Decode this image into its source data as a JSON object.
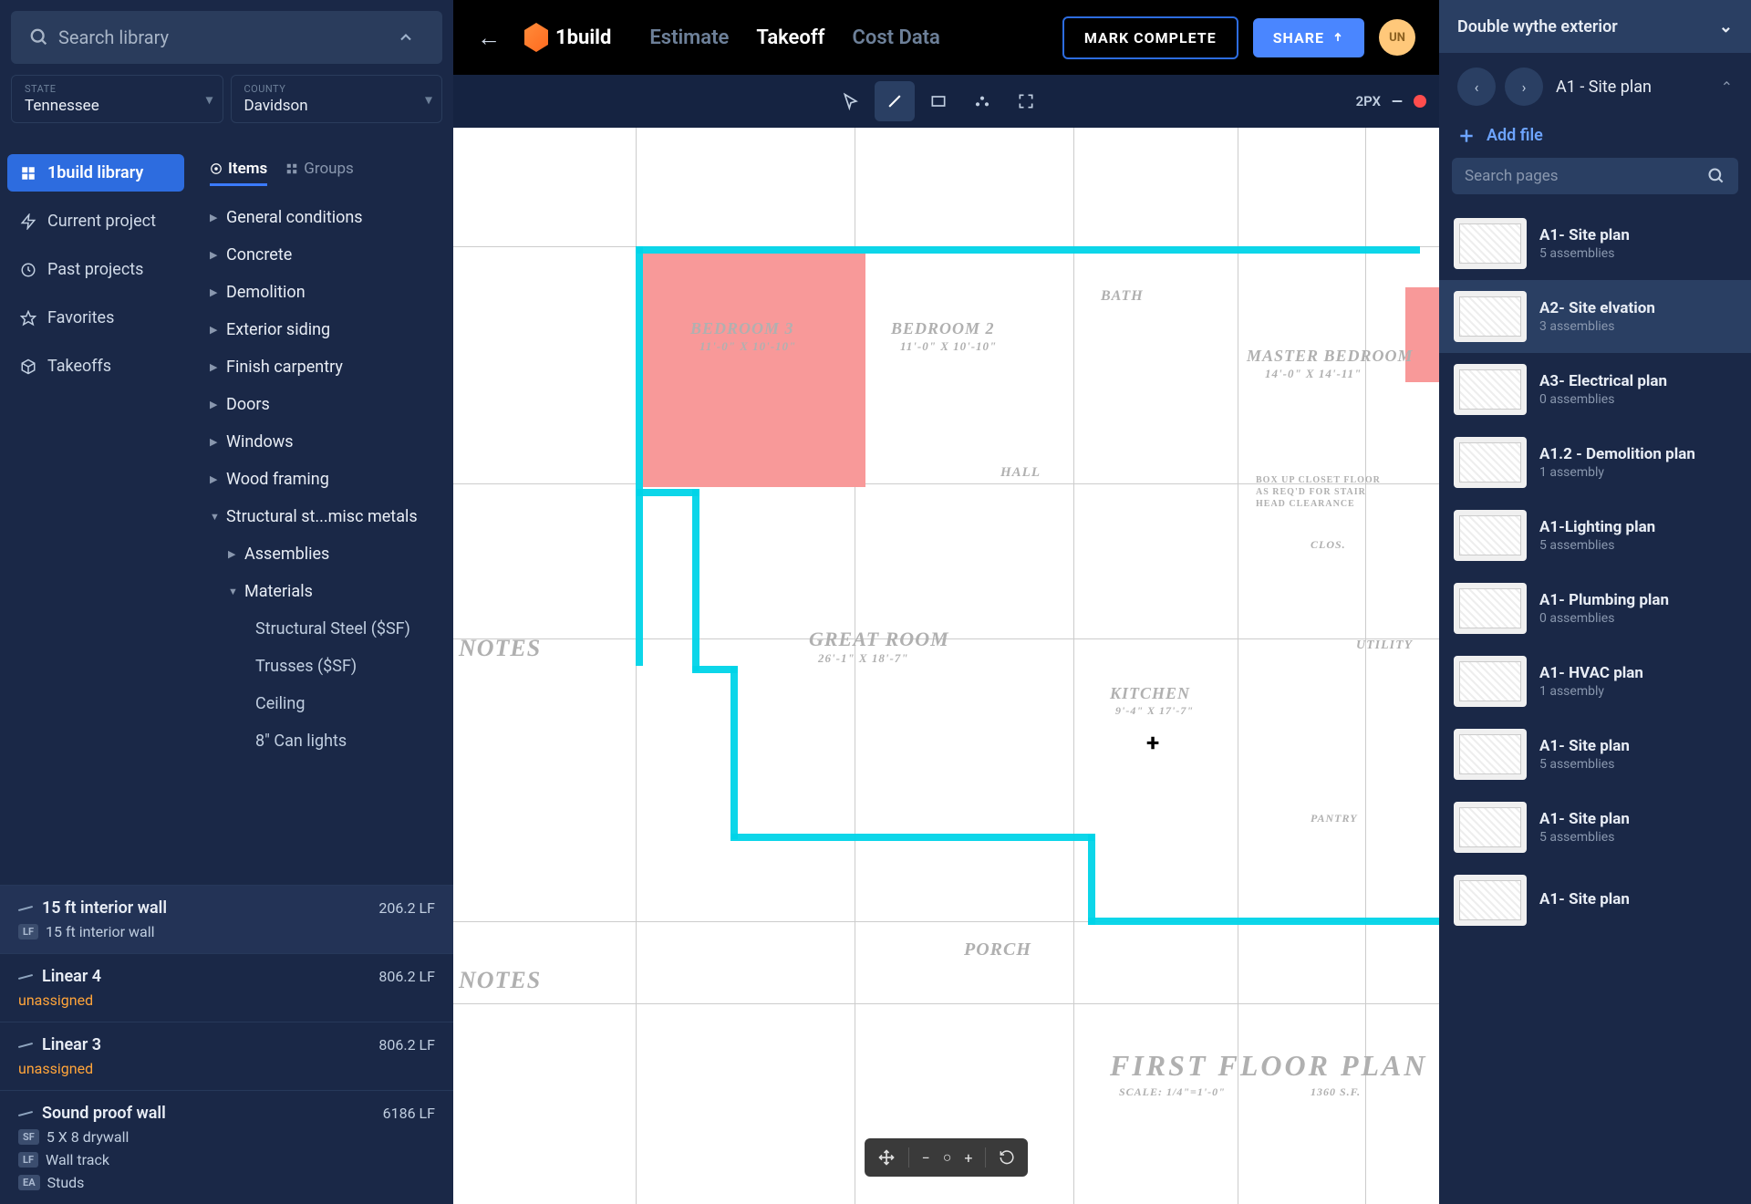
{
  "search": {
    "placeholder": "Search library"
  },
  "selectors": {
    "state": {
      "label": "STATE",
      "value": "Tennessee"
    },
    "county": {
      "label": "COUNTY",
      "value": "Davidson"
    }
  },
  "nav": {
    "library": "1build library",
    "current": "Current project",
    "past": "Past projects",
    "favorites": "Favorites",
    "takeoffs": "Takeoffs"
  },
  "tabs": {
    "items": "Items",
    "groups": "Groups"
  },
  "tree": {
    "general": "General conditions",
    "concrete": "Concrete",
    "demolition": "Demolition",
    "exterior": "Exterior siding",
    "finish": "Finish carpentry",
    "doors": "Doors",
    "windows": "Windows",
    "wood": "Wood framing",
    "structural": "Structural st...misc metals",
    "assemblies": "Assemblies",
    "materials": "Materials",
    "structural_steel": "Structural Steel ($SF)",
    "trusses": "Trusses ($SF)",
    "ceiling": "Ceiling",
    "can_lights": "8\" Can lights"
  },
  "takeoffs": [
    {
      "title": "15 ft interior wall",
      "qty": "206.2 LF",
      "subs": [
        {
          "badge": "LF",
          "text": "15 ft interior wall",
          "warn": false
        }
      ]
    },
    {
      "title": "Linear 4",
      "qty": "806.2 LF",
      "subs": [
        {
          "badge": "",
          "text": "unassigned",
          "warn": true
        }
      ]
    },
    {
      "title": "Linear 3",
      "qty": "806.2 LF",
      "subs": [
        {
          "badge": "",
          "text": "unassigned",
          "warn": true
        }
      ]
    },
    {
      "title": "Sound proof wall",
      "qty": "6186 LF",
      "subs": [
        {
          "badge": "SF",
          "text": "5 X 8 drywall",
          "warn": false
        },
        {
          "badge": "LF",
          "text": "Wall track",
          "warn": false
        },
        {
          "badge": "EA",
          "text": "Studs",
          "warn": false
        }
      ]
    }
  ],
  "brand": "1build",
  "topTabs": {
    "estimate": "Estimate",
    "takeoff": "Takeoff",
    "cost": "Cost Data"
  },
  "actions": {
    "complete": "MARK COMPLETE",
    "share": "SHARE"
  },
  "avatar": "UN",
  "toolbar": {
    "px": "2PX"
  },
  "rightSelect": "Double wythe exterior",
  "rightHead": {
    "title": "A1 - Site plan",
    "add": "Add file",
    "searchPlaceholder": "Search pages"
  },
  "pages": [
    {
      "title": "A1- Site plan",
      "sub": "5 assemblies",
      "selected": false
    },
    {
      "title": "A2- Site elvation",
      "sub": "3 assemblies",
      "selected": true
    },
    {
      "title": "A3- Electrical plan",
      "sub": "0 assemblies",
      "selected": false
    },
    {
      "title": "A1.2 - Demolition plan",
      "sub": "1 assembly",
      "selected": false
    },
    {
      "title": "A1-Lighting plan",
      "sub": "5 assemblies",
      "selected": false
    },
    {
      "title": "A1- Plumbing plan",
      "sub": "0 assemblies",
      "selected": false
    },
    {
      "title": "A1- HVAC plan",
      "sub": "1 assembly",
      "selected": false
    },
    {
      "title": "A1- Site plan",
      "sub": "5 assemblies",
      "selected": false
    },
    {
      "title": "A1- Site plan",
      "sub": "5 assemblies",
      "selected": false
    },
    {
      "title": "A1- Site plan",
      "sub": "",
      "selected": false
    }
  ],
  "plan": {
    "bedroom3": "BEDROOM 3",
    "bedroom3dim": "11'-0\" X 10'-10\"",
    "bedroom2": "BEDROOM 2",
    "bedroom2dim": "11'-0\" X 10'-10\"",
    "bath": "BATH",
    "master": "MASTER BEDROOM",
    "masterdim": "14'-0\" X 14'-11\"",
    "great": "GREAT ROOM",
    "greatdim": "26'-1\" X 18'-7\"",
    "kitchen": "KITCHEN",
    "kitchendim": "9'-4\" X 17'-7\"",
    "hall": "HALL",
    "utility": "UTILITY",
    "clos": "CLOS.",
    "pantry": "PANTRY",
    "porch": "PORCH",
    "title": "FIRST FLOOR PLAN",
    "scale": "SCALE: 1/4\"=1'-0\"",
    "area": "1360 S.F.",
    "notes": "NOTES",
    "closettext": "BOX UP CLOSET FLOOR\nAS REQ'D FOR STAIR\nHEAD CLEARANCE"
  }
}
